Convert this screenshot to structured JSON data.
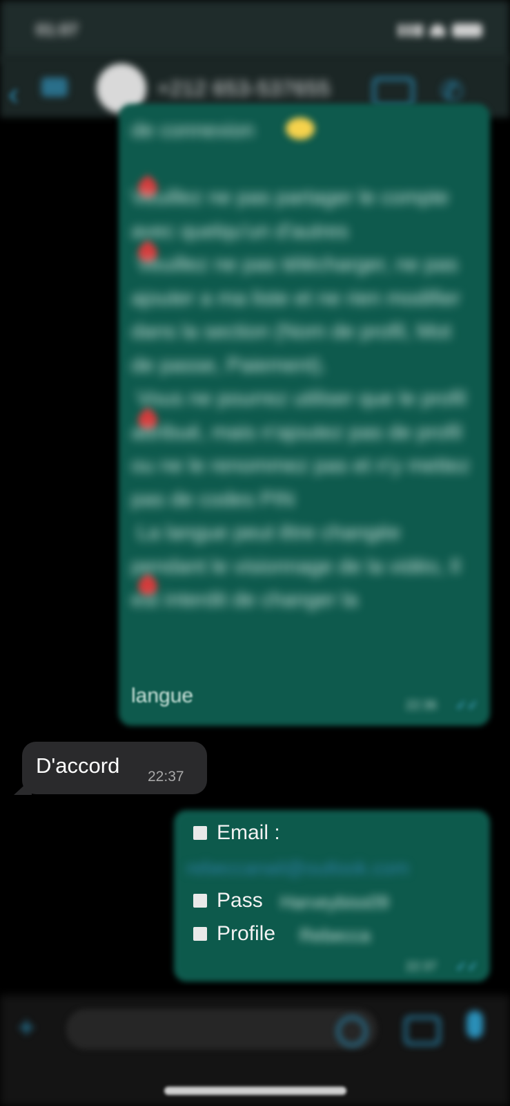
{
  "status_bar": {
    "time": "01:07"
  },
  "header": {
    "back_count": "",
    "contact_name": "+212 653-537655"
  },
  "messages": {
    "outgoing_1": {
      "text": "de connexion \n\nVeuillez ne pas partager le compte avec quelqu'un d'autres\n Veuillez ne pas télécharger, ne pas ajouter a ma liste et ne rien modifier dans la section (Nom de profil, Mot de passe, Paiement).\n Vous ne pourrez utiliser que le profil attribué, mais n'ajoutez pas de profil ou ne le renommez pas et n'y mettez pas de codes PIN\n La langue peut être changée pendant le visionnage de la vidéo, Il est interdit de changer la",
      "last_word": "langue",
      "time": "22:36"
    },
    "incoming_1": {
      "text": "D'accord",
      "time": "22:37"
    },
    "outgoing_2": {
      "email_label": "Email :",
      "email_value": "rebeccanail@outlook.com",
      "pass_label": "Pass",
      "pass_value": "Harveybiss09",
      "profile_label": "Profile",
      "profile_value": "Rebecca",
      "time": "22:37"
    }
  },
  "input": {
    "placeholder": ""
  },
  "colors": {
    "outgoing_bubble": "#0e5a4d",
    "incoming_bubble": "#2a2a2c",
    "accent": "#2a8fb8",
    "read_checks": "#53bdeb"
  }
}
